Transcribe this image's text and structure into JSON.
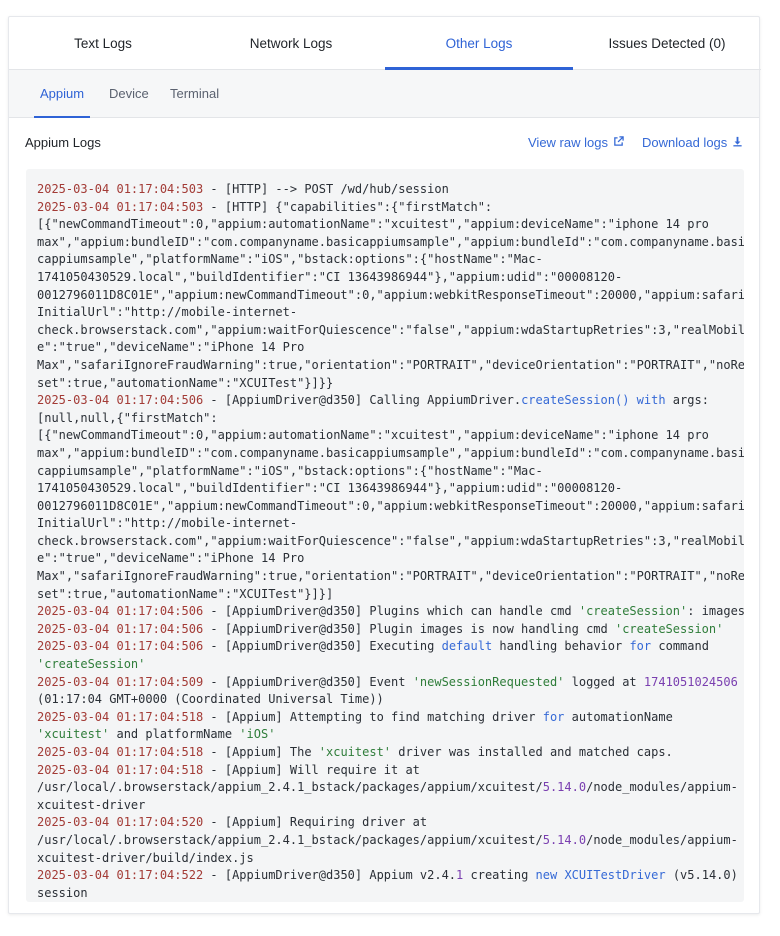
{
  "tabs": [
    {
      "label": "Text Logs",
      "active": false
    },
    {
      "label": "Network Logs",
      "active": false
    },
    {
      "label": "Other Logs",
      "active": true
    },
    {
      "label": "Issues Detected (0)",
      "active": false
    }
  ],
  "subtabs": [
    {
      "label": "Appium",
      "active": true
    },
    {
      "label": "Device",
      "active": false
    },
    {
      "label": "Terminal",
      "active": false
    }
  ],
  "section": {
    "title": "Appium Logs",
    "view_raw_label": "View raw logs",
    "download_label": "Download logs"
  },
  "colors": {
    "accent": "#2f63d6",
    "timestamp": "#a33b36",
    "keyword": "#3569d6",
    "string": "#2f7d3a",
    "number": "#7a3fb0",
    "log_bg": "#f4f5f6"
  },
  "icons": {
    "view_raw": "external-link-icon",
    "download": "download-icon"
  },
  "log_lines": [
    "2025-03-04 01:17:04:503 - [HTTP] --> POST /wd/hub/session",
    "2025-03-04 01:17:04:503 - [HTTP] {\"capabilities\":{\"firstMatch\":",
    "[{\"newCommandTimeout\":0,\"appium:automationName\":\"xcuitest\",\"appium:deviceName\":\"iphone 14 pro",
    "max\",\"appium:bundleID\":\"com.companyname.basicappiumsample\",\"appium:bundleId\":\"com.companyname.basi",
    "cappiumsample\",\"platformName\":\"iOS\",\"bstack:options\":{\"hostName\":\"Mac-",
    "1741050430529.local\",\"buildIdentifier\":\"CI 13643986944\"},\"appium:udid\":\"00008120-",
    "0012796011D8C01E\",\"appium:newCommandTimeout\":0,\"appium:webkitResponseTimeout\":20000,\"appium:safari",
    "InitialUrl\":\"http://mobile-internet-",
    "check.browserstack.com\",\"appium:waitForQuiescence\":\"false\",\"appium:wdaStartupRetries\":3,\"realMobil",
    "e\":\"true\",\"deviceName\":\"iPhone 14 Pro",
    "Max\",\"safariIgnoreFraudWarning\":true,\"orientation\":\"PORTRAIT\",\"deviceOrientation\":\"PORTRAIT\",\"noRe",
    "set\":true,\"automationName\":\"XCUITest\"}]}}",
    "2025-03-04 01:17:04:506 - [AppiumDriver@d350] Calling AppiumDriver.createSession() with args:",
    "[null,null,{\"firstMatch\":",
    "[{\"newCommandTimeout\":0,\"appium:automationName\":\"xcuitest\",\"appium:deviceName\":\"iphone 14 pro",
    "max\",\"appium:bundleID\":\"com.companyname.basicappiumsample\",\"appium:bundleId\":\"com.companyname.basi",
    "cappiumsample\",\"platformName\":\"iOS\",\"bstack:options\":{\"hostName\":\"Mac-",
    "1741050430529.local\",\"buildIdentifier\":\"CI 13643986944\"},\"appium:udid\":\"00008120-",
    "0012796011D8C01E\",\"appium:newCommandTimeout\":0,\"appium:webkitResponseTimeout\":20000,\"appium:safari",
    "InitialUrl\":\"http://mobile-internet-",
    "check.browserstack.com\",\"appium:waitForQuiescence\":\"false\",\"appium:wdaStartupRetries\":3,\"realMobil",
    "e\":\"true\",\"deviceName\":\"iPhone 14 Pro",
    "Max\",\"safariIgnoreFraudWarning\":true,\"orientation\":\"PORTRAIT\",\"deviceOrientation\":\"PORTRAIT\",\"noRe",
    "set\":true,\"automationName\":\"XCUITest\"}]}]",
    "2025-03-04 01:17:04:506 - [AppiumDriver@d350] Plugins which can handle cmd 'createSession': images",
    "2025-03-04 01:17:04:506 - [AppiumDriver@d350] Plugin images is now handling cmd 'createSession'",
    "2025-03-04 01:17:04:506 - [AppiumDriver@d350] Executing default handling behavior for command",
    "'createSession'",
    "2025-03-04 01:17:04:509 - [AppiumDriver@d350] Event 'newSessionRequested' logged at 1741051024506",
    "(01:17:04 GMT+0000 (Coordinated Universal Time))",
    "2025-03-04 01:17:04:518 - [Appium] Attempting to find matching driver for automationName",
    "'xcuitest' and platformName 'iOS'",
    "2025-03-04 01:17:04:518 - [Appium] The 'xcuitest' driver was installed and matched caps.",
    "2025-03-04 01:17:04:518 - [Appium] Will require it at",
    "/usr/local/.browserstack/appium_2.4.1_bstack/packages/appium/xcuitest/5.14.0/node_modules/appium-",
    "xcuitest-driver",
    "2025-03-04 01:17:04:520 - [Appium] Requiring driver at",
    "/usr/local/.browserstack/appium_2.4.1_bstack/packages/appium/xcuitest/5.14.0/node_modules/appium-",
    "xcuitest-driver/build/index.js",
    "2025-03-04 01:17:04:522 - [AppiumDriver@d350] Appium v2.4.1 creating new XCUITestDriver (v5.14.0)",
    "session"
  ]
}
